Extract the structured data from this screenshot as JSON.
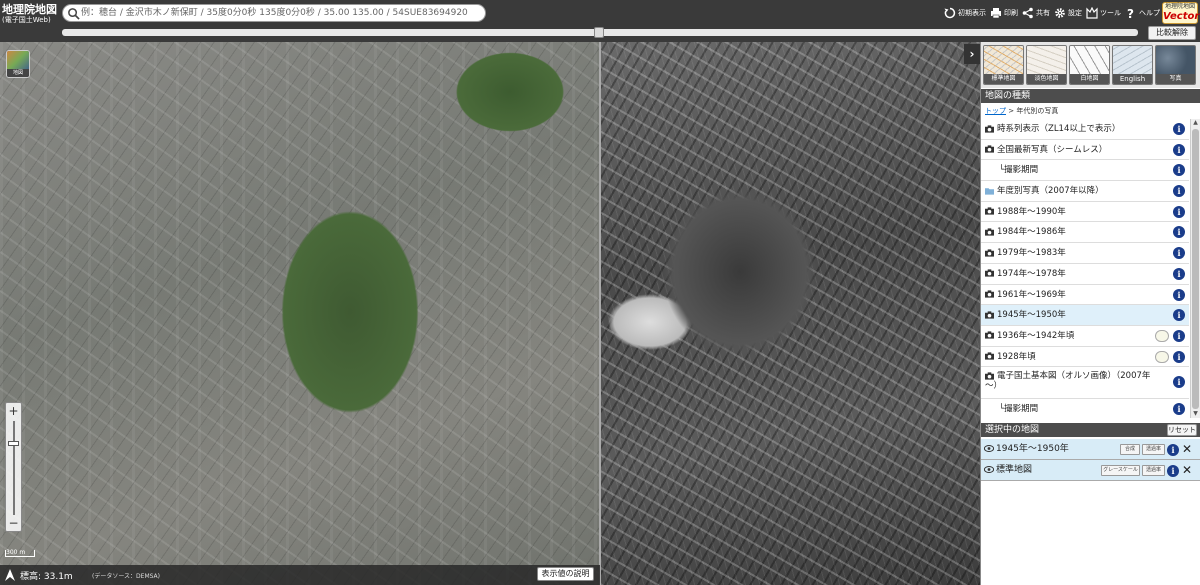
{
  "header": {
    "logo_line1": "地理院地図",
    "logo_line2": "(電子国土Web)",
    "search_placeholder": "例：穂台 / 金沢市木ノ新保町 / 35度0分0秒 135度0分0秒 / 35.00 135.00 / 54SUE83694920",
    "toolbar": [
      {
        "label": "初期表示",
        "icon": "reset-view-icon"
      },
      {
        "label": "印刷",
        "icon": "printer-icon"
      },
      {
        "label": "共有",
        "icon": "share-icon"
      },
      {
        "label": "設定",
        "icon": "gear-icon"
      },
      {
        "label": "ツール",
        "icon": "tools-icon"
      },
      {
        "label": "ヘルプ",
        "icon": "help-icon"
      }
    ],
    "vector_logo_top": "地理院地図",
    "vector_logo_main": "Vector",
    "compare_off": "比較解除",
    "slider_position": 0.5
  },
  "map": {
    "layer_button_caption": "地図",
    "scale_label": "300 m",
    "elevation": "標高: 33.1m",
    "source": "(データソース：DEMSA)",
    "explain_button": "表示値の説明",
    "zoom_in": "+",
    "zoom_out": "−"
  },
  "panel": {
    "toggle": "›",
    "thumbnails": [
      {
        "label": "標準地図",
        "color": "#f0e8d8"
      },
      {
        "label": "淡色地図",
        "color": "#f4f0ea"
      },
      {
        "label": "白地図",
        "color": "#fafafa"
      },
      {
        "label": "English",
        "color": "#dde6ee"
      },
      {
        "label": "写真",
        "color": "#5a6a5a"
      }
    ],
    "map_types_header": "地図の種類",
    "breadcrumb_top": "トップ",
    "breadcrumb_sep": " > ",
    "breadcrumb_current": "年代別の写真",
    "items": [
      {
        "label": "時系列表示（ZL14以上で表示）",
        "icon": "camera",
        "leaf": false,
        "selected": false,
        "sub": false
      },
      {
        "label": "全国最新写真（シームレス）",
        "icon": "camera",
        "leaf": false,
        "selected": false,
        "sub": false
      },
      {
        "label": "└撮影期間",
        "icon": "",
        "leaf": false,
        "selected": false,
        "sub": true
      },
      {
        "label": "年度別写真（2007年以降）",
        "icon": "folder",
        "leaf": false,
        "selected": false,
        "sub": false
      },
      {
        "label": "1988年～1990年",
        "icon": "camera",
        "leaf": false,
        "selected": false,
        "sub": false
      },
      {
        "label": "1984年～1986年",
        "icon": "camera",
        "leaf": false,
        "selected": false,
        "sub": false
      },
      {
        "label": "1979年～1983年",
        "icon": "camera",
        "leaf": false,
        "selected": false,
        "sub": false
      },
      {
        "label": "1974年～1978年",
        "icon": "camera",
        "leaf": false,
        "selected": false,
        "sub": false
      },
      {
        "label": "1961年～1969年",
        "icon": "camera",
        "leaf": false,
        "selected": false,
        "sub": false
      },
      {
        "label": "1945年～1950年",
        "icon": "camera",
        "leaf": false,
        "selected": true,
        "sub": false
      },
      {
        "label": "1936年～1942年頃",
        "icon": "camera",
        "leaf": true,
        "selected": false,
        "sub": false
      },
      {
        "label": "1928年頃",
        "icon": "camera",
        "leaf": true,
        "selected": false,
        "sub": false
      },
      {
        "label": "電子国土基本図（オルソ画像）（2007年～）",
        "icon": "camera",
        "leaf": false,
        "selected": false,
        "sub": false,
        "tall": true
      },
      {
        "label": "└撮影期間",
        "icon": "",
        "leaf": false,
        "selected": false,
        "sub": true
      }
    ],
    "selected_header": "選択中の地図",
    "reset": "リセット",
    "selected": [
      {
        "label": "1945年～1950年",
        "btn1": "合成",
        "btn2": "透過率"
      },
      {
        "label": "標準地図",
        "btn1": "グレースケール",
        "btn2": "透過率"
      }
    ]
  }
}
